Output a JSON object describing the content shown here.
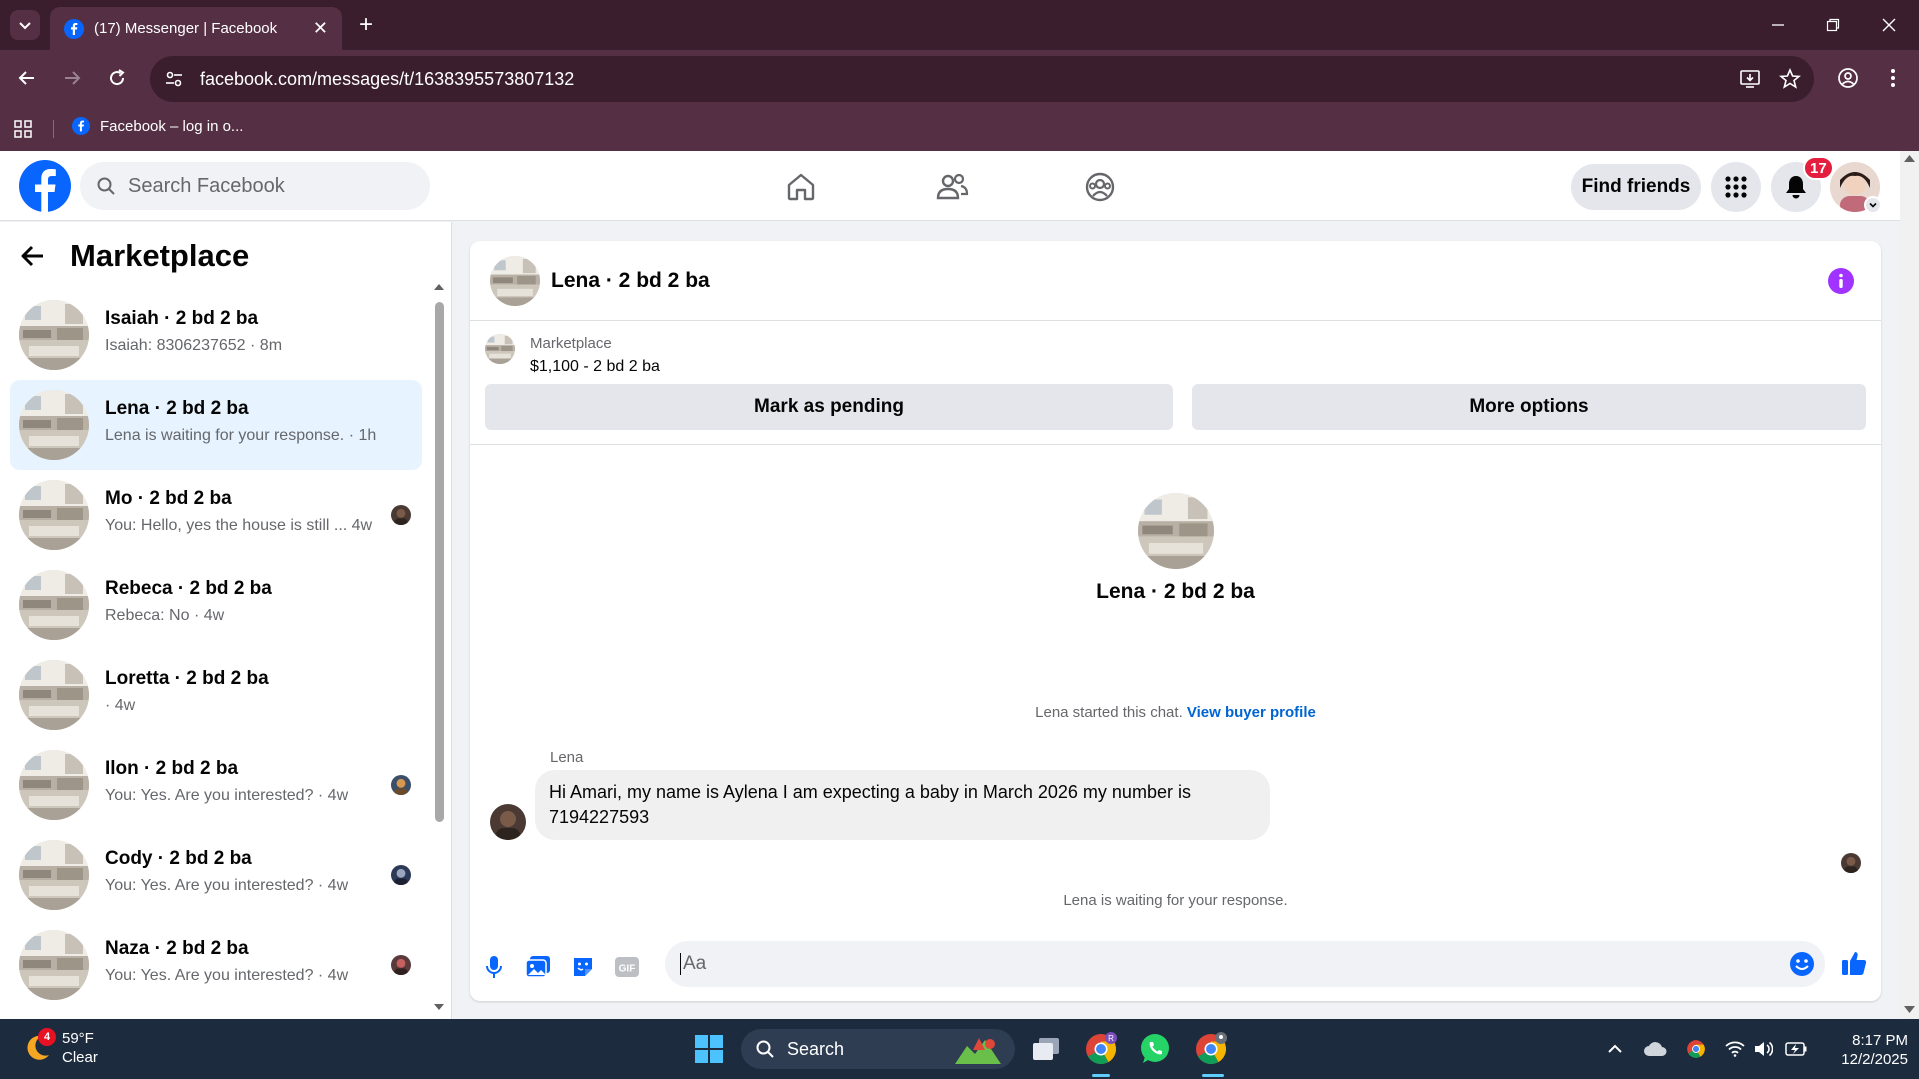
{
  "browser": {
    "tab_title": "(17) Messenger | Facebook",
    "url": "facebook.com/messages/t/1638395573807132",
    "bookmark": "Facebook – log in o..."
  },
  "header": {
    "search_placeholder": "Search Facebook",
    "find_friends": "Find friends",
    "notification_count": "17"
  },
  "sidebar": {
    "title": "Marketplace",
    "conversations": [
      {
        "name": "Isaiah · 2 bd 2 ba",
        "preview": "Isaiah: 8306237652 · 8m"
      },
      {
        "name": "Lena · 2 bd 2 ba",
        "preview": "Lena is waiting for your response. · 1h"
      },
      {
        "name": "Mo · 2 bd 2 ba",
        "preview": "You: Hello, yes the house is still ...   4w"
      },
      {
        "name": "Rebeca · 2 bd 2 ba",
        "preview": "Rebeca: No · 4w"
      },
      {
        "name": "Loretta · 2 bd 2 ba",
        "preview": " · 4w"
      },
      {
        "name": "Ilon · 2 bd 2 ba",
        "preview": "You: Yes. Are you interested? · 4w"
      },
      {
        "name": "Cody · 2 bd 2 ba",
        "preview": "You: Yes. Are you interested? · 4w"
      },
      {
        "name": "Naza · 2 bd 2 ba",
        "preview": "You: Yes. Are you interested? · 4w"
      }
    ]
  },
  "chat": {
    "title": "Lena · 2 bd 2 ba",
    "listing_label": "Marketplace",
    "listing_price": "$1,100 - 2 bd 2 ba",
    "mark_pending": "Mark as pending",
    "more_options": "More options",
    "intro_name": "Lena · 2 bd 2 ba",
    "started_text": "Lena started this chat.",
    "view_profile": "View buyer profile",
    "sender": "Lena",
    "message": "Hi Amari, my name is Aylena I am expecting a baby in March 2026 my number is 7194227593",
    "waiting": "Lena is waiting for your response.",
    "composer_placeholder": "Aa"
  },
  "taskbar": {
    "temp": "59°F",
    "condition": "Clear",
    "weather_badge": "4",
    "search": "Search",
    "time": "8:17 PM",
    "date": "12/2/2025"
  },
  "colors": {
    "fb_blue": "#0866ff",
    "chrome_dark": "#3a1e2e",
    "chrome_mid": "#552f44",
    "active_conv": "#e7f3ff",
    "info_purple": "#a033ff"
  }
}
